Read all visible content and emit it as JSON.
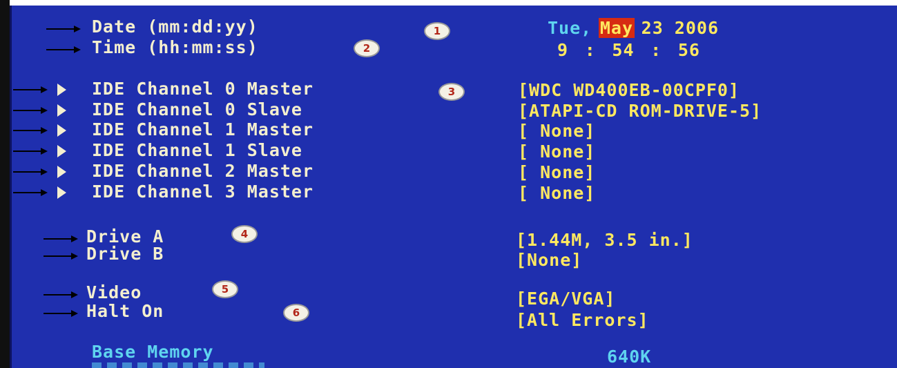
{
  "datetime": {
    "date_label": "Date (mm:dd:yy)",
    "time_label": "Time (hh:mm:ss)",
    "day": "Tue,",
    "month": "May",
    "date_rest": "23 2006",
    "hh": "9",
    "mm": "54",
    "ss": "56",
    "sep": ":"
  },
  "ide": [
    {
      "label": "IDE Channel 0 Master",
      "value": "[WDC WD400EB-00CPF0]"
    },
    {
      "label": "IDE Channel 0 Slave",
      "value": "[ATAPI-CD ROM-DRIVE-5]"
    },
    {
      "label": "IDE Channel 1 Master",
      "value": "[ None]"
    },
    {
      "label": "IDE Channel 1 Slave",
      "value": "[ None]"
    },
    {
      "label": "IDE Channel 2 Master",
      "value": "[ None]"
    },
    {
      "label": "IDE Channel 3 Master",
      "value": "[ None]"
    }
  ],
  "drives": [
    {
      "label": "Drive A",
      "value": "[1.44M, 3.5 in.]"
    },
    {
      "label": "Drive B",
      "value": "[None]"
    }
  ],
  "video": {
    "label": "Video",
    "value": "[EGA/VGA]"
  },
  "halt": {
    "label": "Halt On",
    "value": "[All Errors]"
  },
  "memory": {
    "label": "Base Memory",
    "value": "640K"
  },
  "badges": [
    "1",
    "2",
    "3",
    "4",
    "5",
    "6"
  ],
  "colors": {
    "background": "#1f2fae",
    "label": "#f4efcf",
    "value": "#ffe860",
    "info": "#5fd4ef",
    "highlight": "#d62b12"
  }
}
